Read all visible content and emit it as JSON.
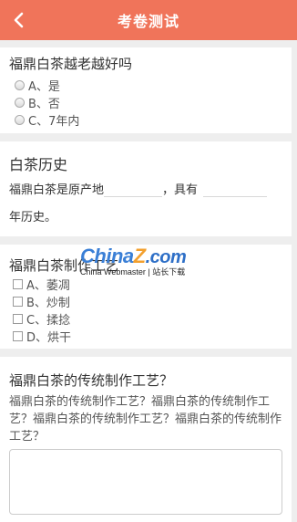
{
  "header": {
    "title": "考卷测试"
  },
  "q1": {
    "title": "福鼎白茶越老越好吗",
    "options": [
      "A、是",
      "B、否",
      "C、7年内"
    ]
  },
  "q2": {
    "title": "白茶历史",
    "text1": "福鼎白茶是原产地",
    "text2": "，具有",
    "text3": "年历史。"
  },
  "q3": {
    "title": "福鼎白茶制作工艺",
    "options": [
      "A、萎凋",
      "B、炒制",
      "C、揉捻",
      "D、烘干"
    ]
  },
  "q4": {
    "title": "福鼎白茶的传统制作工艺？",
    "description": "福鼎白茶的传统制作工艺？福鼎白茶的传统制作工艺？福鼎白茶的传统制作工艺？福鼎白茶的传统制作工艺？",
    "answer": ""
  },
  "watermark": {
    "logo_a": "China",
    "logo_z": "Z",
    "logo_com": ".com",
    "sub": "China Webmaster | 站长下载"
  },
  "colors": {
    "header": "#f0745a",
    "background": "#eeeeee"
  }
}
